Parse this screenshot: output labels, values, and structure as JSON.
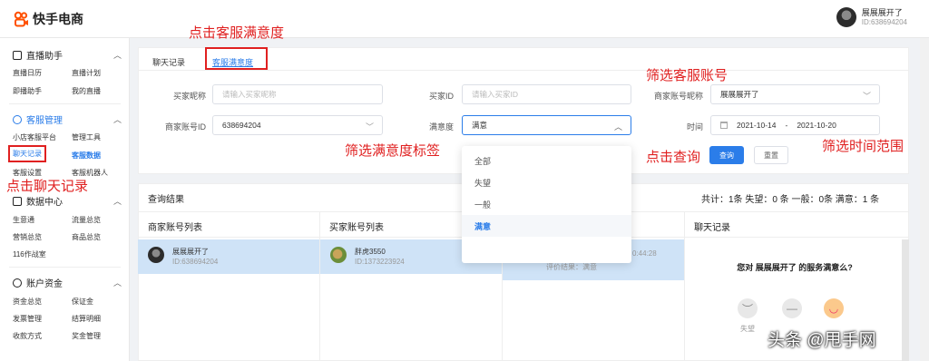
{
  "app": {
    "logo_text": "快手电商",
    "logo_color": "#ff5000"
  },
  "user": {
    "name": "展展展开了",
    "id": "ID:638694204"
  },
  "sidebar": {
    "sections": [
      {
        "title": "直播助手",
        "items": [
          "直播日历",
          "直播计划",
          "即播助手",
          "我的直播"
        ]
      },
      {
        "title": "客服管理",
        "items": [
          "小店客服平台",
          "管理工具",
          "聊天记录",
          "客服数据",
          "客服设置",
          "客服机器人"
        ]
      },
      {
        "title": "数据中心",
        "items": [
          "生意通",
          "流量总览",
          "营销总览",
          "商品总览",
          "116作战室"
        ]
      },
      {
        "title": "账户资金",
        "items": [
          "资金总览",
          "保证金",
          "发票管理",
          "结算明细",
          "收款方式",
          "奖金管理"
        ]
      }
    ]
  },
  "tabs": [
    "聊天记录",
    "客服满意度"
  ],
  "filters": {
    "buyer_nick_label": "买家昵称",
    "buyer_nick_placeholder": "请输入买家昵称",
    "buyer_id_label": "买家ID",
    "buyer_id_placeholder": "请输入买家ID",
    "merchant_nick_label": "商家账号昵称",
    "merchant_nick_value": "展展展开了",
    "merchant_id_label": "商家账号ID",
    "merchant_id_value": "638694204",
    "satisfaction_label": "满意度",
    "satisfaction_value": "满意",
    "time_label": "时间",
    "date_start": "2021-10-14",
    "date_sep": "-",
    "date_end": "2021-10-20",
    "query_button": "查询",
    "reset_button": "重置"
  },
  "satisfaction_options": [
    "全部",
    "失望",
    "一般",
    "满意"
  ],
  "results": {
    "title": "查询结果",
    "summary": "共计：1条 失望：0 条 一般：0条 满意：1 条",
    "merchant_col": "商家账号列表",
    "buyer_col": "买家账号列表",
    "chat_col": "聊天记录",
    "merchant": {
      "name": "展展展开了",
      "id": "ID:638694204"
    },
    "buyer": {
      "name": "胖虎3550",
      "id": "ID:1373223924"
    },
    "session": {
      "time": "0:44:28",
      "result": "评价结果：满意"
    },
    "chat_question": "您对 展展展开了 的服务满意么?",
    "face_labels": [
      "失望"
    ]
  },
  "annotations": {
    "click_satisfaction": "点击客服满意度",
    "filter_account": "筛选客服账号",
    "filter_label": "筛选满意度标签",
    "click_query": "点击查询",
    "filter_time": "筛选时间范围",
    "click_chat": "点击聊天记录"
  },
  "watermark": "头条 @甩手网"
}
